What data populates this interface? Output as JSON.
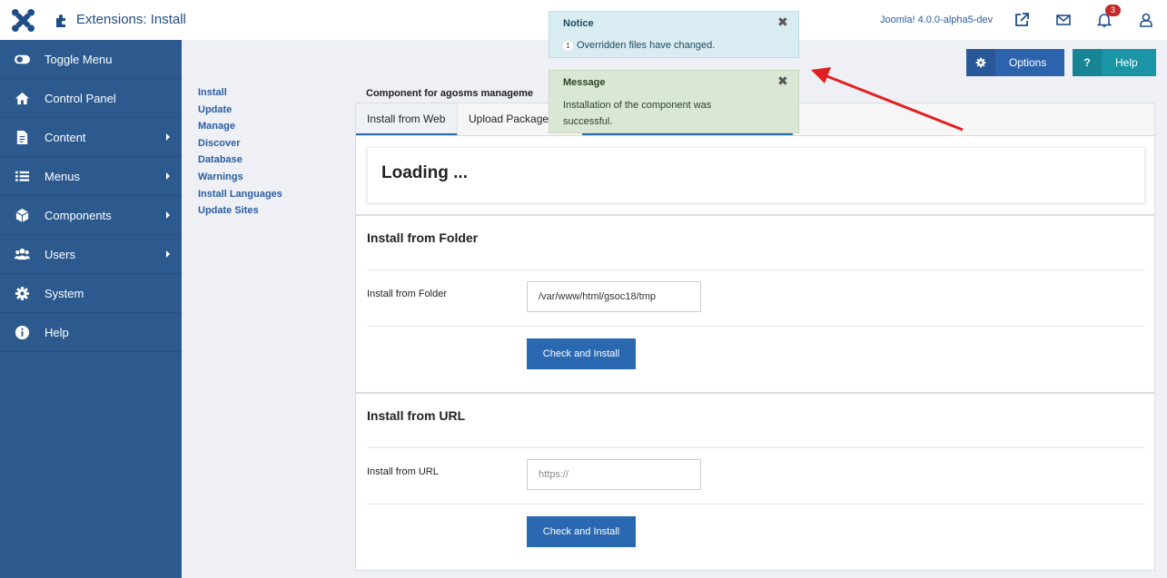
{
  "header": {
    "title": "Extensions: Install",
    "version": "Joomla! 4.0.0-alpha5-dev",
    "notification_count": "3"
  },
  "sidebar": {
    "items": [
      {
        "label": "Toggle Menu",
        "icon": "toggle-icon",
        "submenu": false
      },
      {
        "label": "Control Panel",
        "icon": "home-icon",
        "submenu": false
      },
      {
        "label": "Content",
        "icon": "file-icon",
        "submenu": true
      },
      {
        "label": "Menus",
        "icon": "list-icon",
        "submenu": true
      },
      {
        "label": "Components",
        "icon": "cube-icon",
        "submenu": true
      },
      {
        "label": "Users",
        "icon": "users-icon",
        "submenu": true
      },
      {
        "label": "System",
        "icon": "gear-icon",
        "submenu": false
      },
      {
        "label": "Help",
        "icon": "info-icon",
        "submenu": false
      }
    ]
  },
  "submenu": {
    "items": [
      "Install",
      "Update",
      "Manage",
      "Discover",
      "Database",
      "Warnings",
      "Install Languages",
      "Update Sites"
    ]
  },
  "toolbar": {
    "options_label": "Options",
    "help_label": "Help",
    "help_icon_text": "?"
  },
  "main": {
    "component_heading": "Component for agosms manageme",
    "tabs": [
      {
        "label": "Install from Web"
      },
      {
        "label": "Upload Package"
      }
    ],
    "loading_text": "Loading ...",
    "folder": {
      "heading": "Install from Folder",
      "label": "Install from Folder",
      "value": "/var/www/html/gsoc18/tmp",
      "button": "Check and Install"
    },
    "url": {
      "heading": "Install from URL",
      "label": "Install from URL",
      "placeholder": "https://",
      "button": "Check and Install"
    }
  },
  "alerts": {
    "notice": {
      "title": "Notice",
      "count": "1",
      "text": "Overridden files have changed."
    },
    "message": {
      "title": "Message",
      "line1": "Installation of the component was",
      "line2": "successful."
    },
    "close_glyph": "✖"
  },
  "colors": {
    "sidebar": "#2c5a8f",
    "accent": "#2a69b2",
    "help": "#1995a5",
    "annotation_arrow": "#e02020"
  }
}
